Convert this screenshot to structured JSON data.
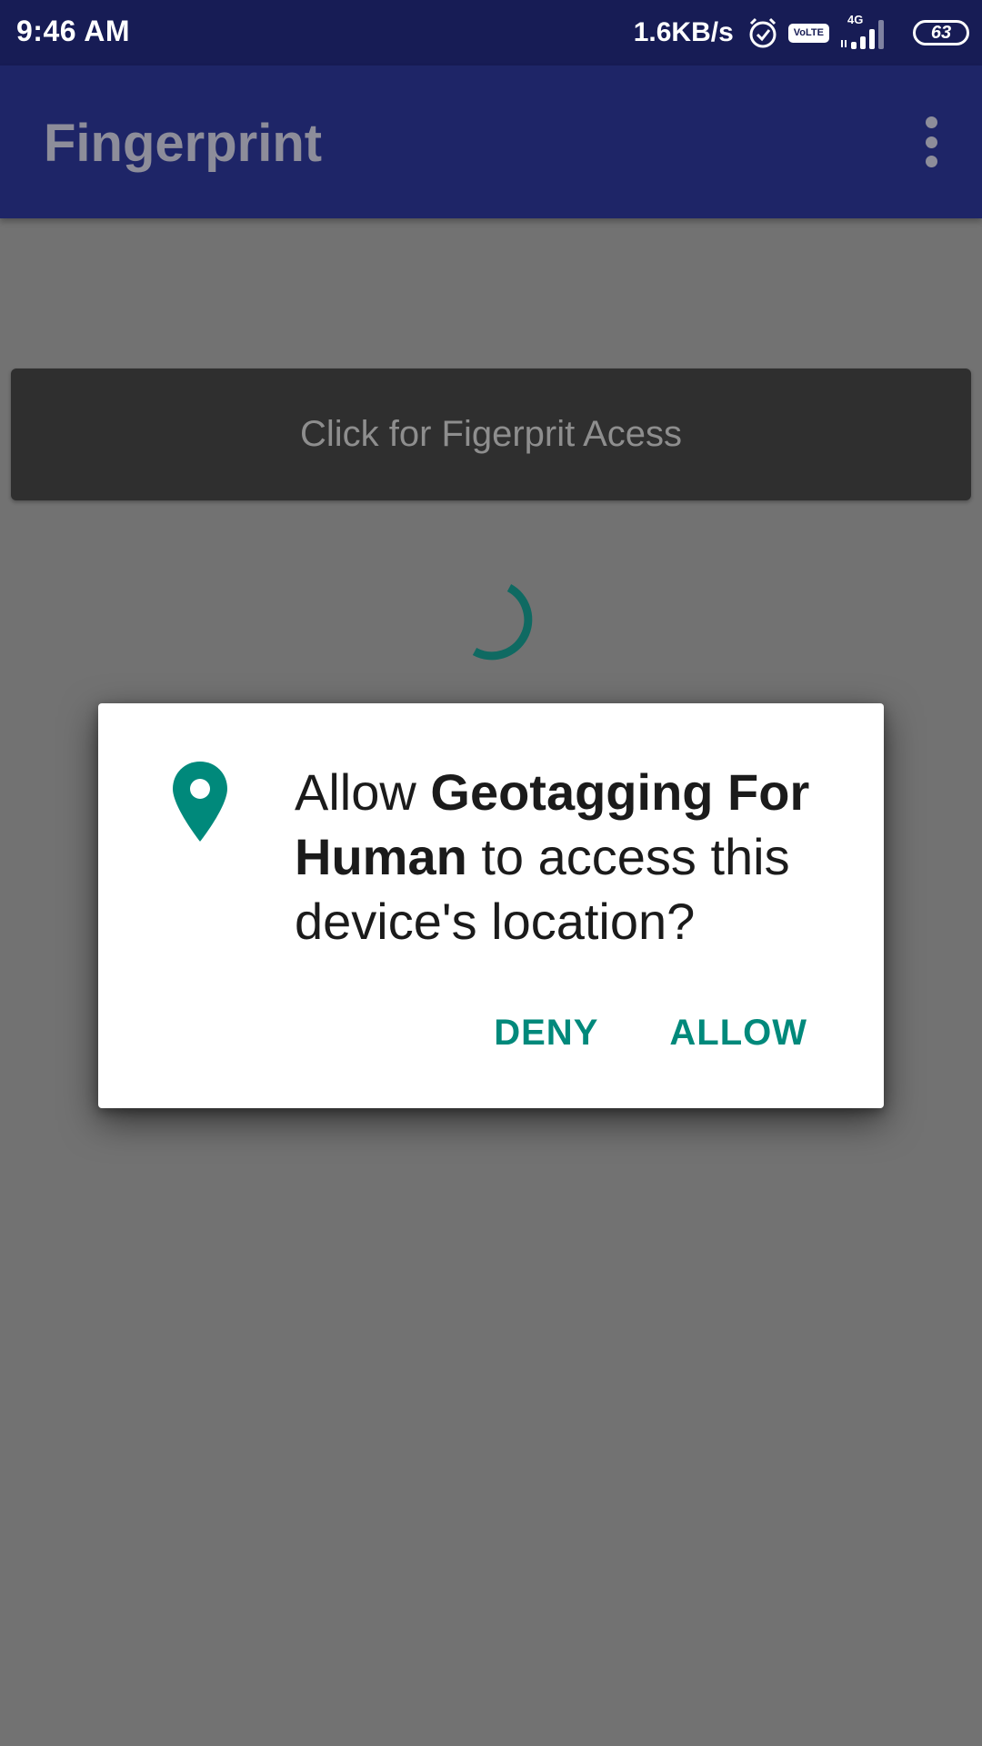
{
  "status_bar": {
    "time": "9:46 AM",
    "net_speed": "1.6KB/s",
    "volte_top": "Vo",
    "volte_bottom": "LTE",
    "network_type": "4G",
    "battery": "63"
  },
  "app_bar": {
    "title": "Fingerprint"
  },
  "main": {
    "button_label": "Click for Figerprit Acess"
  },
  "dialog": {
    "message_prefix": "Allow ",
    "app_name": "Geotagging For Human",
    "message_suffix": " to access this device's location?",
    "deny_label": "DENY",
    "allow_label": "ALLOW"
  },
  "colors": {
    "status_bar": "#171c55",
    "app_bar": "#1e2567",
    "accent": "#00897b",
    "scrim": "#727272"
  }
}
